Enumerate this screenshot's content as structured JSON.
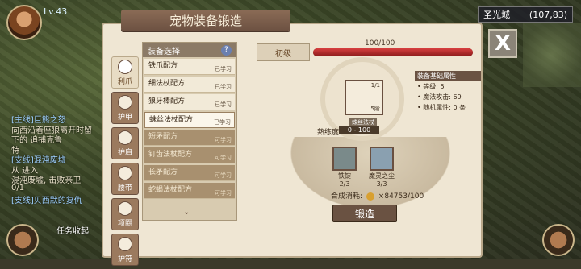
{
  "hud": {
    "player_name": "Lv.43",
    "location_name": "圣光城",
    "location_coords": "(107,83)",
    "quests": [
      {
        "text": "[主线]巨熊之怒",
        "kind": "title"
      },
      {
        "text": "向西沿着座狼离开时留",
        "kind": "body"
      },
      {
        "text": "下的  追捕克鲁",
        "kind": "body"
      },
      {
        "text": "特",
        "kind": "body"
      },
      {
        "text": "[支线]混沌废墟",
        "kind": "title"
      },
      {
        "text": "从  进入",
        "kind": "body"
      },
      {
        "text": "混沌废墟, 击败亲卫",
        "kind": "body"
      },
      {
        "text": "0/1",
        "kind": "body"
      },
      {
        "text": "[支线]贝西默的复仇",
        "kind": "title"
      }
    ],
    "collapse_label": "任务收起"
  },
  "panel": {
    "title": "宠物装备锻造",
    "close_label": "X"
  },
  "tabs": [
    {
      "label": "利爪",
      "active": true
    },
    {
      "label": "护甲",
      "active": false
    },
    {
      "label": "护肩",
      "active": false
    },
    {
      "label": "腰带",
      "active": false
    },
    {
      "label": "项圈",
      "active": false
    },
    {
      "label": "护符",
      "active": false
    }
  ],
  "list": {
    "header": "装备选择",
    "help": "?",
    "items": [
      {
        "name": "铁爪配方",
        "status": "已学习",
        "state": "learned"
      },
      {
        "name": "细法杖配方",
        "status": "已学习",
        "state": "learned"
      },
      {
        "name": "狼牙棒配方",
        "status": "已学习",
        "state": "learned"
      },
      {
        "name": "蛛丝法杖配方",
        "status": "已学习",
        "state": "selected"
      },
      {
        "name": "短矛配方",
        "status": "可学习",
        "state": "unlearned"
      },
      {
        "name": "钉齿法杖配方",
        "status": "可学习",
        "state": "unlearned"
      },
      {
        "name": "长矛配方",
        "status": "可学习",
        "state": "unlearned"
      },
      {
        "name": "蛇蝎法杖配方",
        "status": "可学习",
        "state": "unlearned"
      }
    ]
  },
  "forge": {
    "level_label": "初级",
    "level_progress": "100/100",
    "level_fraction": 1.0,
    "item_count": "1/1",
    "item_level": "5阶",
    "item_name": "蛛丝法杖",
    "proficiency_label": "熟练度",
    "proficiency_value": "0 - 100",
    "materials": [
      {
        "name": "铁锭",
        "count": "2/3"
      },
      {
        "name": "魔灵之尘",
        "count": "3/3"
      }
    ],
    "cost_label": "合成消耗:",
    "cost_value": "×84753/100",
    "forge_button": "锻造"
  },
  "attributes": {
    "header": "装备基础属性",
    "rows": [
      "• 等级: 5",
      "• 魔法攻击: 69",
      "• 随机属性: 0 条"
    ]
  }
}
